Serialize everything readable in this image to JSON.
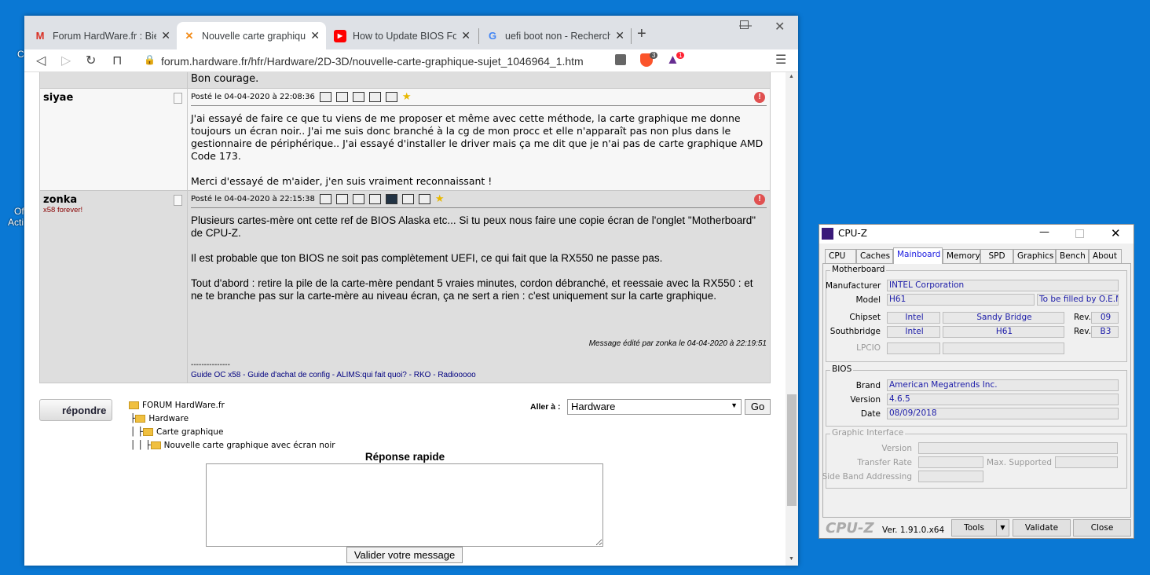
{
  "desktop": {
    "icon_labels": [
      "C",
      "Of",
      "Acti"
    ]
  },
  "browser": {
    "tabs": [
      {
        "label": "Forum HardWare.fr : Bienvenue",
        "icon": "gmail-icon",
        "active": false
      },
      {
        "label": "Nouvelle carte graphique avec écran noir",
        "icon": "hfr-icon",
        "active": true
      },
      {
        "label": "How to Update BIOS For AMD",
        "icon": "youtube-icon",
        "active": false
      },
      {
        "label": "uefi boot non - Recherche Google",
        "icon": "google-icon",
        "active": false
      }
    ],
    "new_tab": "+",
    "url": "forum.hardware.fr/hfr/Hardware/2D-3D/nouvelle-carte-graphique-sujet_1046964_1.htm",
    "brave_badge": "3",
    "rewards_badge": "1"
  },
  "forum": {
    "prev_post_tail": "Bon courage.",
    "posts": [
      {
        "author": "siyae",
        "subtitle": "",
        "date": "Posté le 04-04-2020 à 22:08:36",
        "paragraphs": [
          "J'ai essayé de faire ce que tu viens de me proposer et même avec cette méthode, la carte graphique me donne toujours un écran noir.. J'ai me suis donc branché à la cg de mon procc et elle n'apparaît pas non plus dans le gestionnaire de périphérique.. J'ai essayé d'installer le driver mais ça me dit que je n'ai pas de carte graphique AMD Code 173.",
          "Merci d'essayé de m'aider, j'en suis vraiment reconnaissant !"
        ]
      },
      {
        "author": "zonka",
        "subtitle": "x58 forever!",
        "date": "Posté le 04-04-2020 à 22:15:38",
        "paragraphs": [
          "Plusieurs cartes-mère ont cette ref de BIOS Alaska etc... Si tu peux nous faire une copie écran de l'onglet \"Motherboard\" de CPU-Z.",
          "Il est probable que ton BIOS ne soit pas complètement UEFI, ce qui fait que la RX550 ne passe pas.",
          "Tout d'abord : retire la pile de la carte-mère pendant 5 vraies minutes, cordon débranché, et reessaie avec la RX550 : et ne te branche pas sur la carte-mère au niveau écran, ça ne sert a rien : c'est uniquement sur la carte graphique."
        ],
        "edited": "Message édité par zonka le 04-04-2020 à 22:19:51",
        "sig_sep": "---------------",
        "sig_links": [
          "Guide OC x58",
          "Guide d'achat de config",
          "ALIMS:qui fait quoi?",
          "RKO",
          "Radiooooo"
        ]
      }
    ],
    "reply_button": "répondre",
    "breadcrumb": [
      "FORUM HardWare.fr",
      "Hardware",
      "Carte graphique",
      "Nouvelle carte graphique avec écran noir"
    ],
    "goto_label": "Aller à :",
    "goto_value": "Hardware",
    "go_button": "Go",
    "quick_reply_title": "Réponse rapide",
    "submit_button": "Valider votre message"
  },
  "cpuz": {
    "title": "CPU-Z",
    "tabs": [
      "CPU",
      "Caches",
      "Mainboard",
      "Memory",
      "SPD",
      "Graphics",
      "Bench",
      "About"
    ],
    "active_tab": "Mainboard",
    "motherboard": {
      "group": "Motherboard",
      "manufacturer_label": "Manufacturer",
      "manufacturer": "INTEL Corporation",
      "model_label": "Model",
      "model": "H61",
      "model_extra": "To be filled by O.E.M.",
      "chipset_label": "Chipset",
      "chipset_vendor": "Intel",
      "chipset_name": "Sandy Bridge",
      "rev_label": "Rev.",
      "chipset_rev": "09",
      "southbridge_label": "Southbridge",
      "sb_vendor": "Intel",
      "sb_name": "H61",
      "sb_rev": "B3",
      "lpcio_label": "LPCIO"
    },
    "bios": {
      "group": "BIOS",
      "brand_label": "Brand",
      "brand": "American Megatrends Inc.",
      "version_label": "Version",
      "version": "4.6.5",
      "date_label": "Date",
      "date": "08/09/2018"
    },
    "gi": {
      "group": "Graphic Interface",
      "version_label": "Version",
      "transfer_label": "Transfer Rate",
      "max_label": "Max. Supported",
      "sba_label": "Side Band Addressing"
    },
    "footer": {
      "logo": "CPU-Z",
      "version": "Ver. 1.91.0.x64",
      "tools": "Tools",
      "validate": "Validate",
      "close": "Close"
    }
  }
}
